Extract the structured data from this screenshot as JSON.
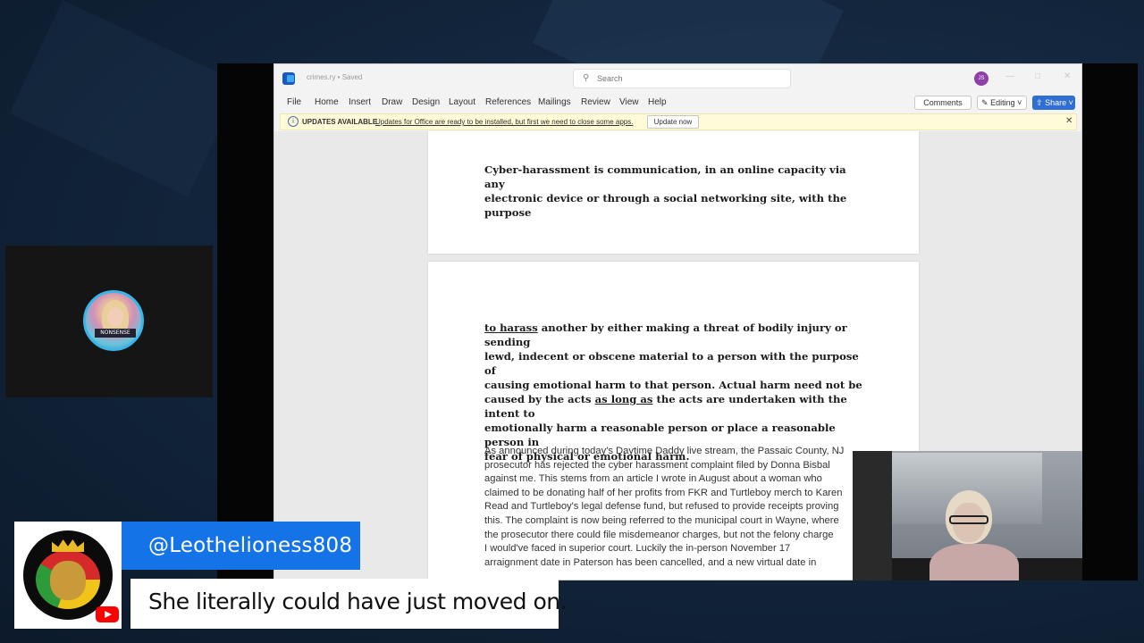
{
  "word": {
    "doc_title": "crimes.ry • Saved",
    "search_placeholder": "Search",
    "user_initials": "JS",
    "menu": [
      "File",
      "Home",
      "Insert",
      "Draw",
      "Design",
      "Layout",
      "References",
      "Mailings",
      "Review",
      "View",
      "Help"
    ],
    "comments_label": "Comments",
    "editing_label": "Editing",
    "share_label": "Share",
    "update_bar": {
      "title": "UPDATES AVAILABLE",
      "message": "Updates for Office are ready to be installed, but first we need to close some apps.",
      "button": "Update now"
    },
    "page1_text": [
      "Cyber-harassment is communication, in an online capacity via any",
      "electronic device or through a social networking site, with the purpose"
    ],
    "page2_bold": {
      "l1_a": "to harass",
      "l1_b": " another by either making a threat of bodily injury or sending",
      "l2": "lewd, indecent or obscene material to a person with the purpose of",
      "l3": "causing emotional harm to that person. Actual harm need not be",
      "l4_a": "caused by the acts ",
      "l4_b": "as long as",
      "l4_c": " the acts are undertaken with the intent to",
      "l5": "emotionally harm a reasonable person or place a reasonable person in",
      "l6": "fear of physical or emotional harm."
    },
    "page2_body": [
      "As announced during today's Daytime Daddy live stream, the Passaic County, NJ",
      "prosecutor has rejected the cyber harassment complaint filed by Donna Bisbal",
      "against me. This stems from an article I wrote in August about a woman who",
      "claimed to be donating half of her profits from FKR and Turtleboy merch to Karen",
      "Read and Turtleboy's legal defense fund, but refused to provide receipts proving",
      "this. The complaint is now being referred to the municipal court in Wayne, where",
      "the prosecutor there could file misdemeanor charges, but not the felony charge",
      "I would've faced in superior court. Luckily the in-person November 17",
      "arraignment date in Paterson has been cancelled, and a new virtual date in"
    ]
  },
  "side_avatar_badge": "NONSENSE",
  "chat": {
    "username": "@Leothelioness808",
    "message": "She literally could have just moved on.",
    "platform_icon": "youtube-icon"
  },
  "colors": {
    "word_blue": "#185abd",
    "share_blue": "#2f6fd5",
    "chat_name_bg": "#1573e8",
    "update_bar_bg": "#fffbd8"
  }
}
